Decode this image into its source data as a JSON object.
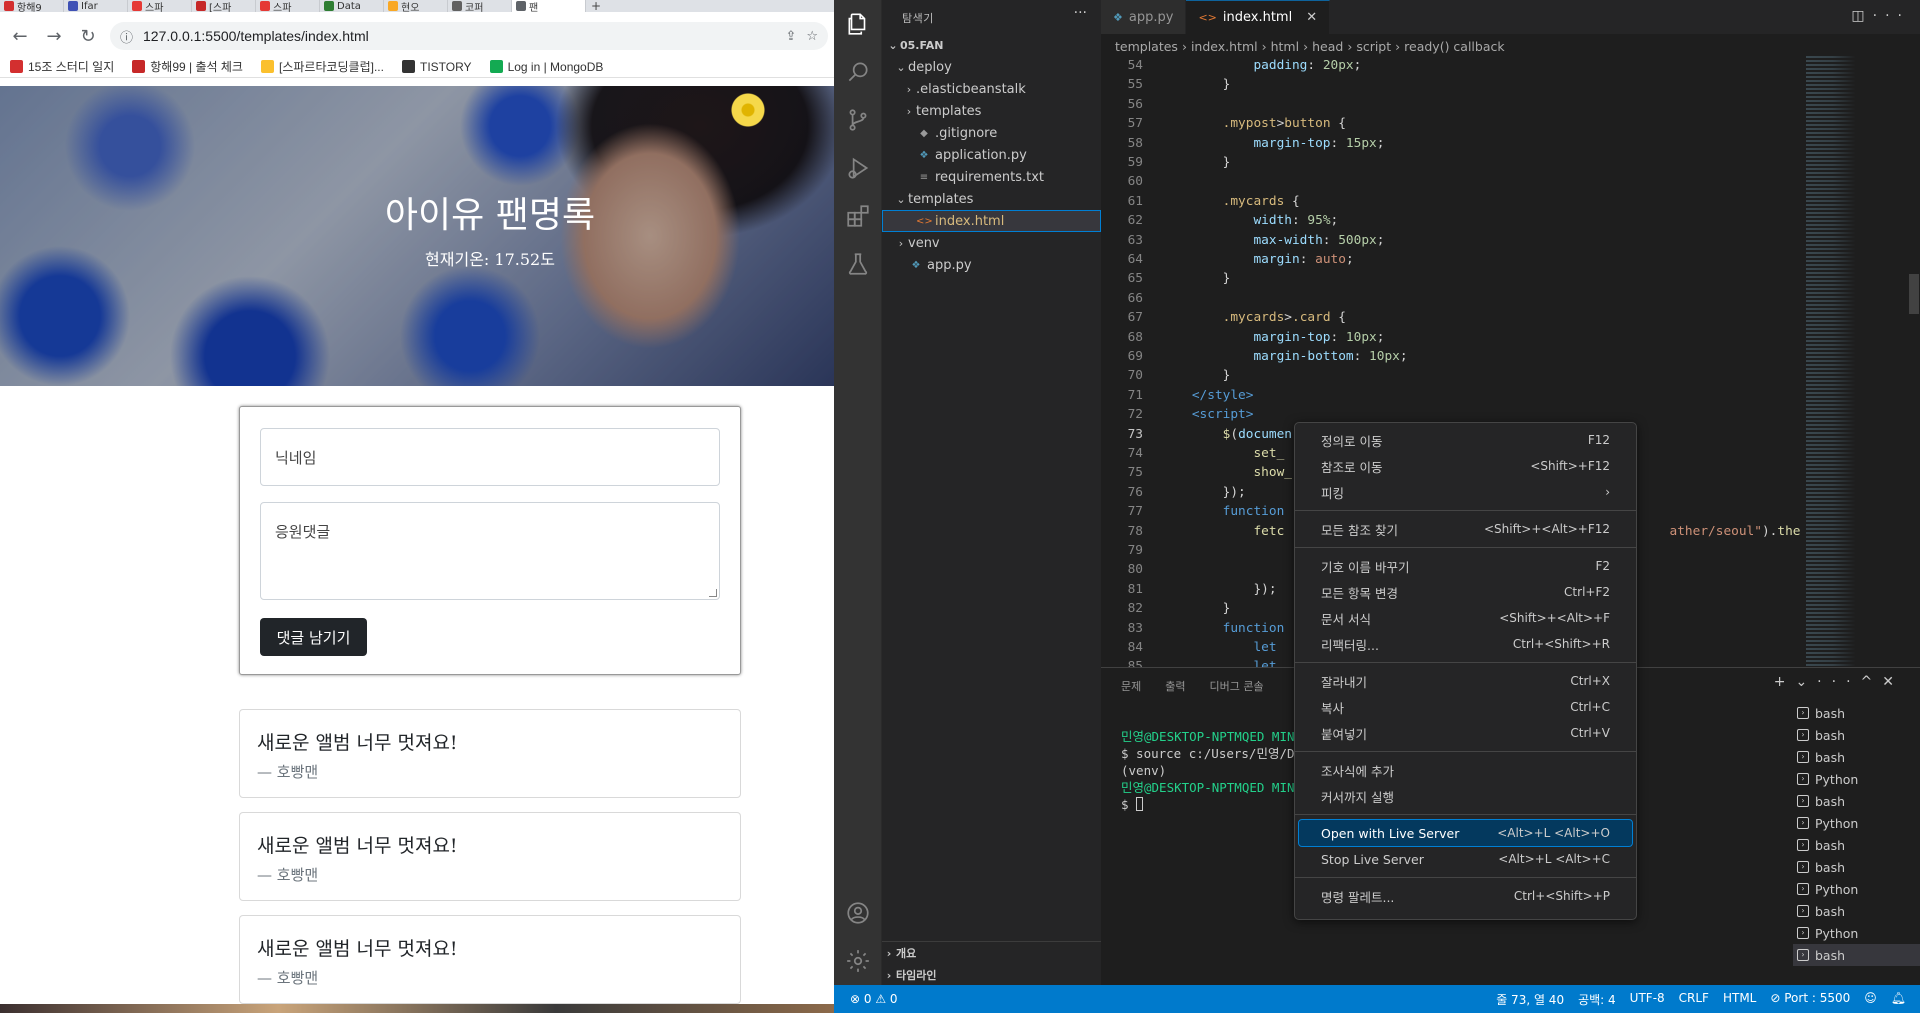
{
  "browser": {
    "tabs": [
      {
        "label": "항해9",
        "color": "#d32f2f"
      },
      {
        "label": "Ifar",
        "color": "#3f51b5"
      },
      {
        "label": "스파",
        "color": "#e53935"
      },
      {
        "label": "[스파",
        "color": "#c62828"
      },
      {
        "label": "스파",
        "color": "#e53935"
      },
      {
        "label": "Data",
        "color": "#2e7d32"
      },
      {
        "label": "현오",
        "color": "#f9a825"
      },
      {
        "label": "코퍼",
        "color": "#616161"
      },
      {
        "label": "팬",
        "color": "#5f6368"
      }
    ],
    "new_tab": "+",
    "url": "127.0.0.1:5500/templates/index.html",
    "bookmarks": [
      {
        "label": "15조 스터디 일지",
        "color": "#d32f2f"
      },
      {
        "label": "항해99 | 출석 체크",
        "color": "#c62828"
      },
      {
        "label": "[스파르타코딩클럽]...",
        "color": "#fbc02d"
      },
      {
        "label": "TISTORY",
        "color": "#333333"
      },
      {
        "label": "Log in | MongoDB",
        "color": "#13aa52"
      }
    ]
  },
  "page": {
    "title": "아이유 팬명록",
    "temp": "현재기온: 17.52도",
    "nick_placeholder": "닉네임",
    "comment_placeholder": "응원댓글",
    "post_button": "댓글 남기기",
    "cards": [
      {
        "comment": "새로운 앨범 너무 멋져요!",
        "author": "— 호빵맨"
      },
      {
        "comment": "새로운 앨범 너무 멋져요!",
        "author": "— 호빵맨"
      },
      {
        "comment": "새로운 앨범 너무 멋져요!",
        "author": "— 호빵맨"
      }
    ]
  },
  "vscode": {
    "explorer_title": "탐색기",
    "tree": [
      {
        "label": "05.FAN",
        "icon": "",
        "chevron": "⌄",
        "head": true
      },
      {
        "label": "deploy",
        "icon": "",
        "chevron": "⌄"
      },
      {
        "label": ".elasticbeanstalk",
        "icon": "",
        "chevron": "›"
      },
      {
        "label": "templates",
        "icon": "",
        "chevron": "›"
      },
      {
        "label": ".gitignore",
        "icon": "◆",
        "chevron": ""
      },
      {
        "label": "application.py",
        "icon": "❖",
        "chevron": ""
      },
      {
        "label": "requirements.txt",
        "icon": "≡",
        "chevron": ""
      },
      {
        "label": "templates",
        "icon": "",
        "chevron": "⌄"
      },
      {
        "label": "index.html",
        "icon": "<>",
        "chevron": ""
      },
      {
        "label": "venv",
        "icon": "",
        "chevron": "›"
      },
      {
        "label": "app.py",
        "icon": "❖",
        "chevron": ""
      }
    ],
    "outline": "개요",
    "timeline": "타임라인",
    "tabs": [
      {
        "label": "app.py",
        "icon": "❖"
      },
      {
        "label": "index.html",
        "icon": "<>"
      }
    ],
    "breadcrumb": [
      "templates",
      "index.html",
      "html",
      "head",
      "script",
      "ready() callback"
    ],
    "code": [
      {
        "n": "54",
        "html": "            <span class='prop'>padding</span><span class='pun'>: </span><span class='num'>20px</span><span class='pun'>;</span>"
      },
      {
        "n": "55",
        "html": "        <span class='pun'>}</span>"
      },
      {
        "n": "56",
        "html": ""
      },
      {
        "n": "57",
        "html": "        <span class='sel'>.mypost</span><span class='pun'>&gt;</span><span class='sel'>button</span> <span class='pun'>{</span>"
      },
      {
        "n": "58",
        "html": "            <span class='prop'>margin-top</span><span class='pun'>: </span><span class='num'>15px</span><span class='pun'>;</span>"
      },
      {
        "n": "59",
        "html": "        <span class='pun'>}</span>"
      },
      {
        "n": "60",
        "html": ""
      },
      {
        "n": "61",
        "html": "        <span class='sel'>.mycards</span> <span class='pun'>{</span>"
      },
      {
        "n": "62",
        "html": "            <span class='prop'>width</span><span class='pun'>: </span><span class='num'>95%</span><span class='pun'>;</span>"
      },
      {
        "n": "63",
        "html": "            <span class='prop'>max-width</span><span class='pun'>: </span><span class='num'>500px</span><span class='pun'>;</span>"
      },
      {
        "n": "64",
        "html": "            <span class='prop'>margin</span><span class='pun'>: </span><span class='str'>auto</span><span class='pun'>;</span>"
      },
      {
        "n": "65",
        "html": "        <span class='pun'>}</span>"
      },
      {
        "n": "66",
        "html": ""
      },
      {
        "n": "67",
        "html": "        <span class='sel'>.mycards</span><span class='pun'>&gt;</span><span class='sel'>.card</span> <span class='pun'>{</span>"
      },
      {
        "n": "68",
        "html": "            <span class='prop'>margin-top</span><span class='pun'>: </span><span class='num'>10px</span><span class='pun'>;</span>"
      },
      {
        "n": "69",
        "html": "            <span class='prop'>margin-bottom</span><span class='pun'>: </span><span class='num'>10px</span><span class='pun'>;</span>"
      },
      {
        "n": "70",
        "html": "        <span class='pun'>}</span>"
      },
      {
        "n": "71",
        "html": "    <span class='tag'>&lt;/style&gt;</span>"
      },
      {
        "n": "72",
        "html": "    <span class='tag'>&lt;script&gt;</span>"
      },
      {
        "n": "73",
        "html": "        <span class='fn'>$</span><span class='pun'>(</span><span class='vr'>documen</span>",
        "cur": true
      },
      {
        "n": "74",
        "html": "            <span class='fn'>set_</span>"
      },
      {
        "n": "75",
        "html": "            <span class='fn'>show_</span>"
      },
      {
        "n": "76",
        "html": "        <span class='pun'>});</span>"
      },
      {
        "n": "77",
        "html": "        <span class='kw'>function</span>"
      },
      {
        "n": "78",
        "html": "            <span class='fn'>fetc</span>                                                  <span class='str'>ather/seoul\"</span><span class='pun'>).</span><span class='fn'>then</span><span class='pun'>((</span><span class='vr'>re</span>"
      },
      {
        "n": "79",
        "html": ""
      },
      {
        "n": "80",
        "html": ""
      },
      {
        "n": "81",
        "html": "            <span class='pun'>});</span>"
      },
      {
        "n": "82",
        "html": "        <span class='pun'>}</span>"
      },
      {
        "n": "83",
        "html": "        <span class='kw'>function</span>"
      },
      {
        "n": "84",
        "html": "            <span class='kw'>let</span>"
      },
      {
        "n": "85",
        "html": "            <span class='kw'>let</span>"
      }
    ],
    "panel_tabs": [
      "문제",
      "출력",
      "디버그 콘솔"
    ],
    "terminal": [
      {
        "user": "민영@DESKTOP-NPTMQED MING",
        "rest": ""
      },
      {
        "user": "",
        "rest": "$ source c:/Users/민영/De                                  e"
      },
      {
        "user": "",
        "rest": "(venv)"
      },
      {
        "user": "민영@DESKTOP-NPTMQED MING",
        "rest": ""
      },
      {
        "user": "",
        "rest": "$ ",
        "cursor": true
      }
    ],
    "terminals": [
      "bash",
      "bash",
      "bash",
      "Python",
      "bash",
      "Python",
      "bash",
      "bash",
      "Python",
      "bash",
      "Python",
      "bash"
    ],
    "status_left": "⊗ 0 ⚠ 0",
    "status_right": [
      "줄 73, 열 40",
      "공백: 4",
      "UTF-8",
      "CRLF",
      "HTML",
      "⊘ Port : 5500"
    ]
  },
  "context_menu": [
    {
      "label": "정의로 이동",
      "key": "F12"
    },
    {
      "label": "참조로 이동",
      "key": "<Shift>+F12"
    },
    {
      "label": "피킹",
      "key": "›"
    },
    {
      "sep": true
    },
    {
      "label": "모든 참조 찾기",
      "key": "<Shift>+<Alt>+F12"
    },
    {
      "sep": true
    },
    {
      "label": "기호 이름 바꾸기",
      "key": "F2"
    },
    {
      "label": "모든 항목 변경",
      "key": "Ctrl+F2"
    },
    {
      "label": "문서 서식",
      "key": "<Shift>+<Alt>+F"
    },
    {
      "label": "리팩터링...",
      "key": "Ctrl+<Shift>+R"
    },
    {
      "sep": true
    },
    {
      "label": "잘라내기",
      "key": "Ctrl+X"
    },
    {
      "label": "복사",
      "key": "Ctrl+C"
    },
    {
      "label": "붙여넣기",
      "key": "Ctrl+V"
    },
    {
      "sep": true
    },
    {
      "label": "조사식에 추가",
      "key": ""
    },
    {
      "label": "커서까지 실행",
      "key": ""
    },
    {
      "sep": true
    },
    {
      "label": "Open with Live Server",
      "key": "<Alt>+L <Alt>+O",
      "highlight": true
    },
    {
      "label": "Stop Live Server",
      "key": "<Alt>+L <Alt>+C"
    },
    {
      "sep": true
    },
    {
      "label": "명령 팔레트...",
      "key": "Ctrl+<Shift>+P"
    }
  ]
}
